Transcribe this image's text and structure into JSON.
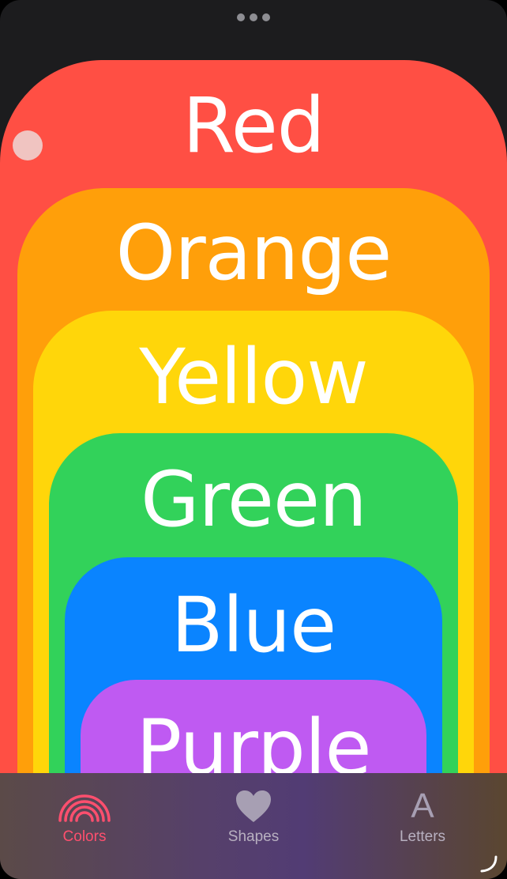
{
  "window": {
    "menu_icon": "ellipsis-icon"
  },
  "cards": [
    {
      "label": "Red",
      "color": "#ff4f44"
    },
    {
      "label": "Orange",
      "color": "#ff9f0a"
    },
    {
      "label": "Yellow",
      "color": "#ffd60a"
    },
    {
      "label": "Green",
      "color": "#32d25a"
    },
    {
      "label": "Blue",
      "color": "#0a84ff"
    },
    {
      "label": "Purple",
      "color": "#bf5af2"
    }
  ],
  "tabbar": {
    "tabs": [
      {
        "label": "Colors",
        "icon": "rainbow-icon",
        "active": true,
        "color": "#ff4f6e"
      },
      {
        "label": "Shapes",
        "icon": "heart-icon",
        "active": false
      },
      {
        "label": "Letters",
        "icon": "letter-a-icon",
        "active": false,
        "glyph": "A"
      }
    ]
  }
}
